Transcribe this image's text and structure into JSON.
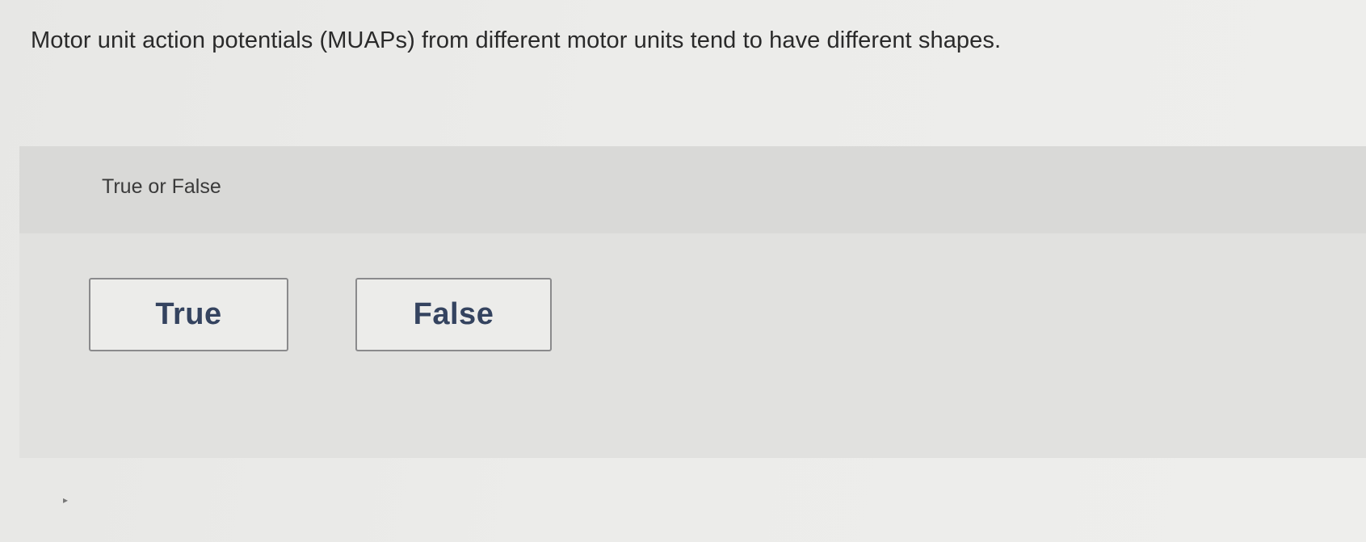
{
  "question": {
    "text": "Motor unit action potentials (MUAPs) from different motor units tend to have different shapes."
  },
  "answer_panel": {
    "prompt": "True or False",
    "choices": [
      {
        "label": "True"
      },
      {
        "label": "False"
      }
    ]
  },
  "colors": {
    "page_background": "#ececea",
    "panel_background": "#e1e1df",
    "prompt_band": "#d9d9d7",
    "choice_text": "#34435f",
    "choice_border": "#8a8a8c"
  }
}
